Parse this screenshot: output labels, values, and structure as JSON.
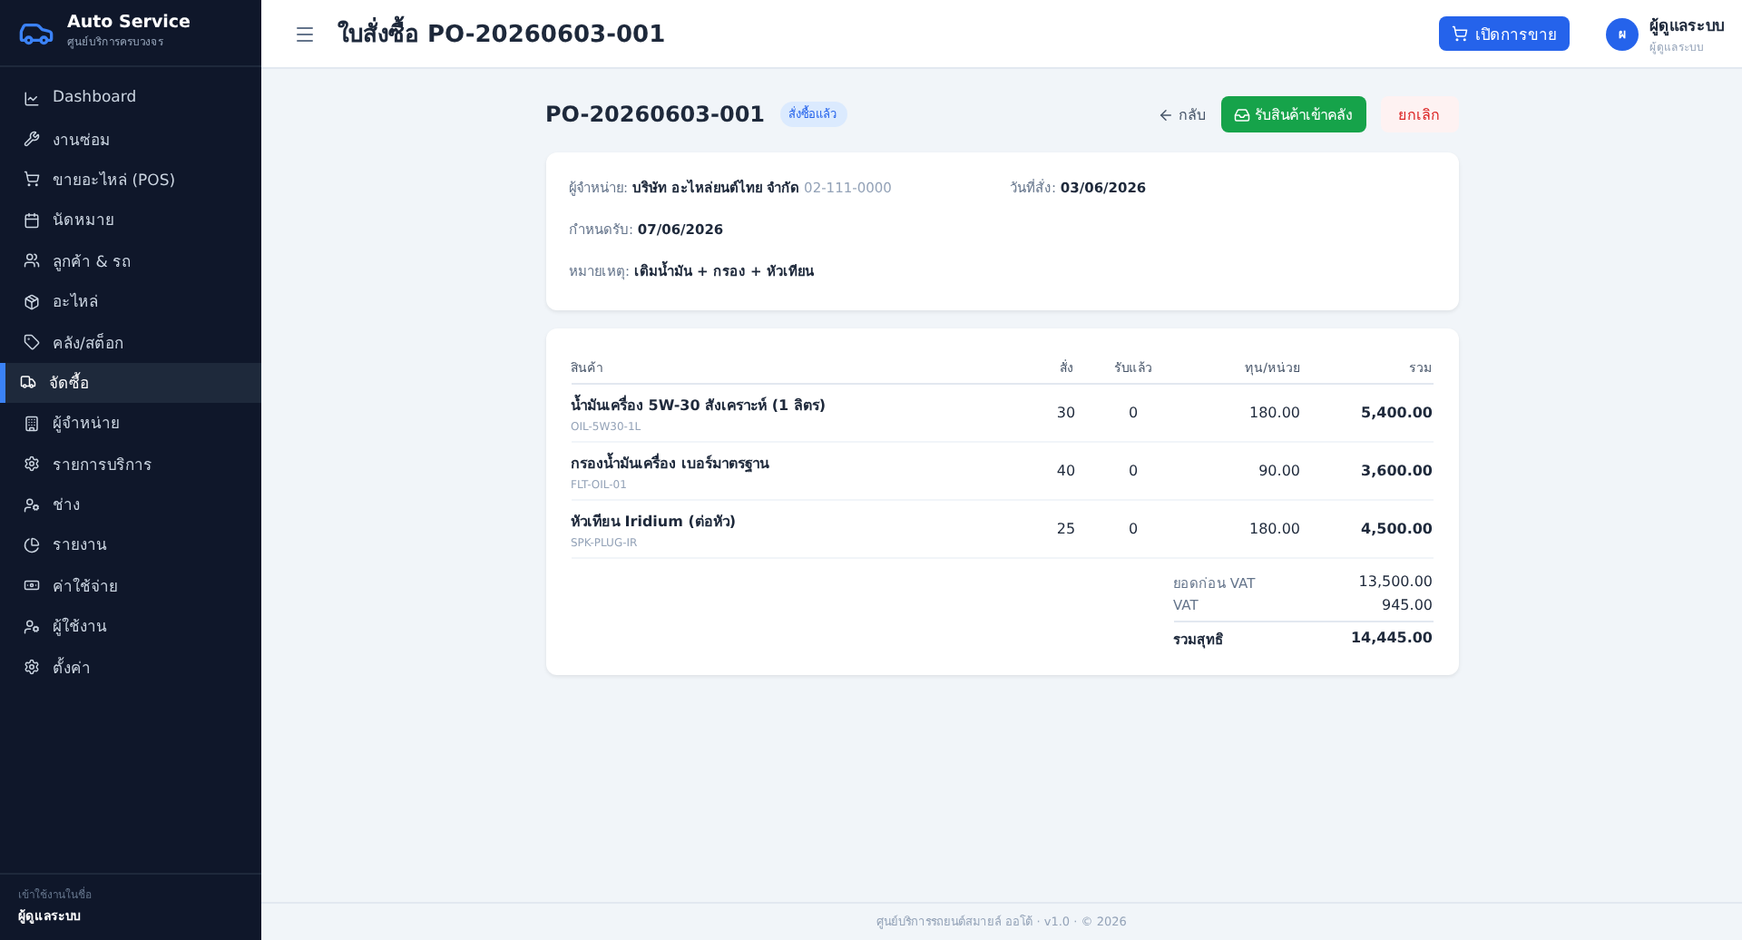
{
  "sidebar": {
    "brand": {
      "title": "Auto Service",
      "subtitle": "ศูนย์บริการครบวงจร"
    },
    "items": [
      {
        "label": "Dashboard",
        "selected": false
      },
      {
        "label": "งานซ่อม",
        "selected": false
      },
      {
        "label": "ขายอะไหล่ (POS)",
        "selected": false
      },
      {
        "label": "นัดหมาย",
        "selected": false
      },
      {
        "label": "ลูกค้า & รถ",
        "selected": false
      },
      {
        "label": "อะไหล่",
        "selected": false
      },
      {
        "label": "คลัง/สต็อก",
        "selected": false
      },
      {
        "label": "จัดซื้อ",
        "selected": true
      },
      {
        "label": "ผู้จำหน่าย",
        "selected": false
      },
      {
        "label": "รายการบริการ",
        "selected": false
      },
      {
        "label": "ช่าง",
        "selected": false
      },
      {
        "label": "รายงาน",
        "selected": false
      },
      {
        "label": "ค่าใช้จ่าย",
        "selected": false
      },
      {
        "label": "ผู้ใช้งาน",
        "selected": false
      },
      {
        "label": "ตั้งค่า",
        "selected": false
      }
    ],
    "footer": {
      "caption": "เข้าใช้งานในชื่อ",
      "user": "ผู้ดูแลระบบ"
    }
  },
  "topbar": {
    "title": "ใบสั่งซื้อ PO-20260603-001",
    "pos_button": "เปิดการขาย",
    "avatar": "ผ",
    "user_name": "ผู้ดูแลระบบ",
    "user_role": "ผู้ดูแลระบบ"
  },
  "order": {
    "number": "PO-20260603-001",
    "status": "สั่งซื้อแล้ว",
    "back_link": "กลับ",
    "receive_button": "รับสินค้าเข้าคลัง",
    "cancel_button": "ยกเลิก"
  },
  "details": {
    "supplier_label": "ผู้จำหน่าย:",
    "supplier": "บริษัท อะไหล่ยนต์ไทย จำกัด",
    "supplier_phone": "02-111-0000",
    "order_date_label": "วันที่สั่ง:",
    "order_date": "03/06/2026",
    "due_label": "กำหนดรับ:",
    "due_date": "07/06/2026",
    "note_label": "หมายเหตุ:",
    "note": "เติมน้ำมัน + กรอง + หัวเทียน"
  },
  "table": {
    "columns": [
      "สินค้า",
      "สั่ง",
      "รับแล้ว",
      "ทุน/หน่วย",
      "รวม"
    ],
    "rows": [
      {
        "name": "น้ำมันเครื่อง 5W-30 สังเคราะห์ (1 ลิตร)",
        "sku": "OIL-5W30-1L",
        "ordered": "30",
        "received": "0",
        "unit_cost": "180.00",
        "total": "5,400.00"
      },
      {
        "name": "กรองน้ำมันเครื่อง เบอร์มาตรฐาน",
        "sku": "FLT-OIL-01",
        "ordered": "40",
        "received": "0",
        "unit_cost": "90.00",
        "total": "3,600.00"
      },
      {
        "name": "หัวเทียน Iridium (ต่อหัว)",
        "sku": "SPK-PLUG-IR",
        "ordered": "25",
        "received": "0",
        "unit_cost": "180.00",
        "total": "4,500.00"
      }
    ],
    "summary": [
      {
        "label": "ยอดก่อน VAT",
        "value": "13,500.00",
        "kind": "normal"
      },
      {
        "label": "VAT",
        "value": "945.00",
        "kind": "normal"
      },
      {
        "label": "รวมสุทธิ",
        "value": "14,445.00",
        "kind": "grand"
      }
    ]
  },
  "footer": "ศูนย์บริการรถยนต์สมายล์ ออโต้ · v1.0 · © 2026"
}
